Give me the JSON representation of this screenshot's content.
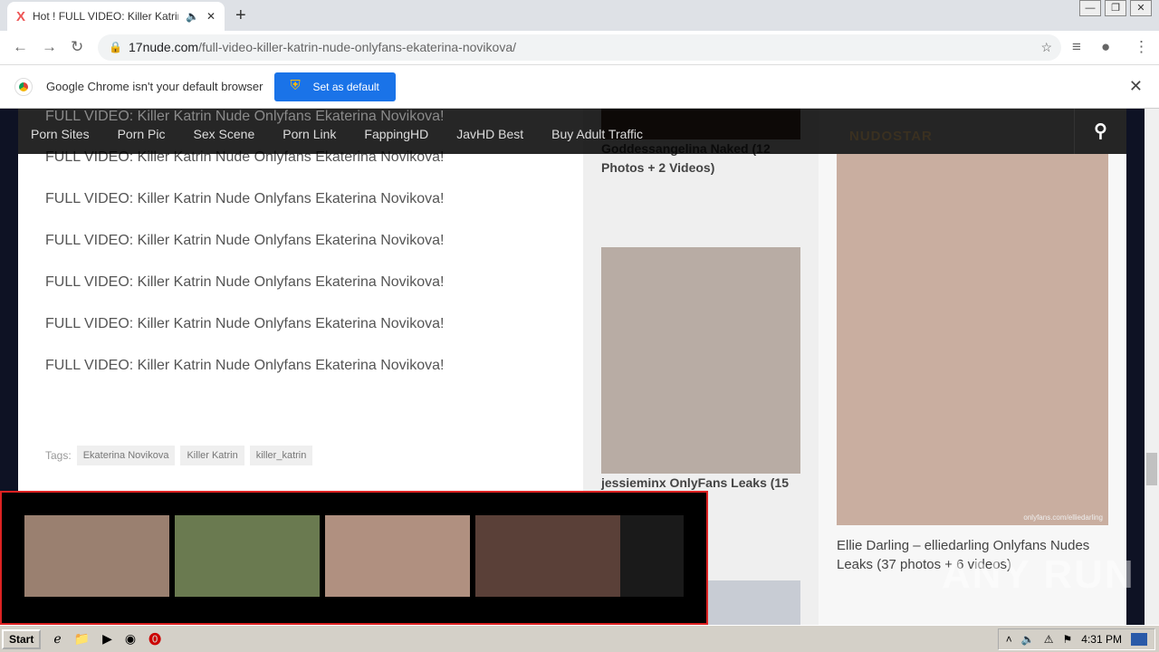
{
  "browser": {
    "tab_title": "Hot ! FULL VIDEO: Killer Katrin N",
    "url_host": "17nude.com",
    "url_path": "/full-video-killer-katrin-nude-onlyfans-ekaterina-novikova/",
    "window_controls": [
      "—",
      "❐",
      "✕"
    ]
  },
  "infobar": {
    "message": "Google Chrome isn't your default browser",
    "button": "Set as default"
  },
  "nav": {
    "items": [
      "Porn Sites",
      "Porn Pic",
      "Sex Scene",
      "Porn Link",
      "FappingHD",
      "JavHD Best",
      "Buy Adult Traffic"
    ]
  },
  "article": {
    "image_alts": [
      "FULL VIDEO: Killer Katrin Nude Onlyfans Ekaterina Novikova!",
      "FULL VIDEO: Killer Katrin Nude Onlyfans Ekaterina Novikova!",
      "FULL VIDEO: Killer Katrin Nude Onlyfans Ekaterina Novikova!",
      "FULL VIDEO: Killer Katrin Nude Onlyfans Ekaterina Novikova!",
      "FULL VIDEO: Killer Katrin Nude Onlyfans Ekaterina Novikova!",
      "FULL VIDEO: Killer Katrin Nude Onlyfans Ekaterina Novikova!",
      "FULL VIDEO: Killer Katrin Nude Onlyfans Ekaterina Novikova!"
    ],
    "tags_label": "Tags:",
    "tags": [
      "Ekaterina Novikova",
      "Killer Katrin",
      "killer_katrin"
    ]
  },
  "sidebar": {
    "post1": "Goddessangelina Naked (12 Photos + 2 Videos)",
    "post2": "jessieminx OnlyFans Leaks (15",
    "logo": "NUDOSTAR",
    "post3": "Ellie Darling – elliedarling Onlyfans Nudes Leaks (37 photos + 6 videos)",
    "image_watermark": "onlyfans.com/elliedarling"
  },
  "watermark": "ANY RUN",
  "taskbar": {
    "start": "Start",
    "clock": "4:31 PM"
  }
}
